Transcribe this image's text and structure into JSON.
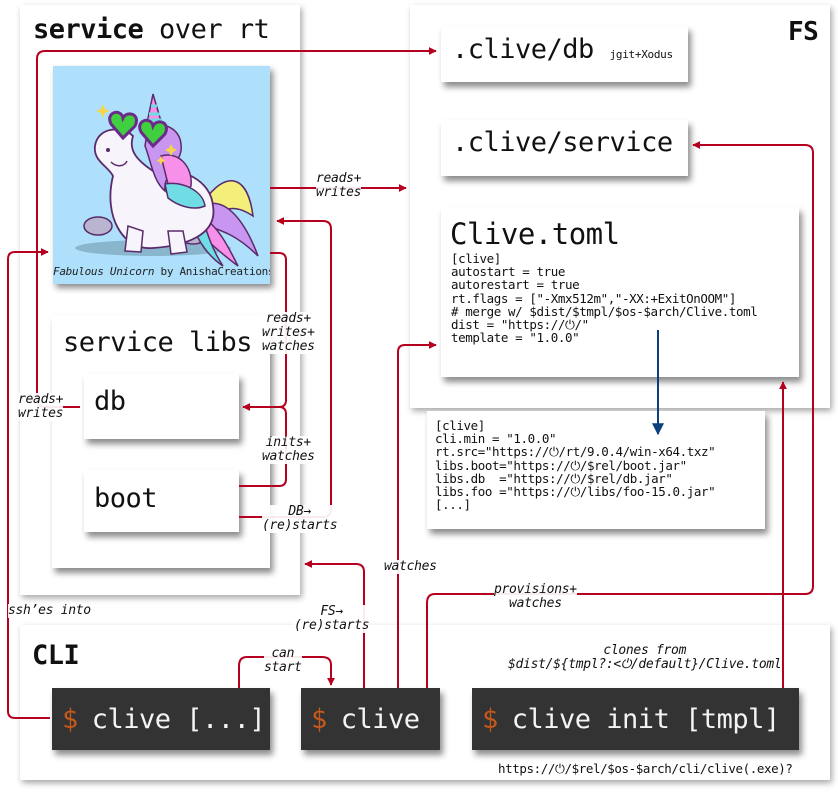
{
  "service_panel": {
    "title_bold": "service",
    "title_rest": " over rt",
    "image_caption_title": "Fabulous Unicorn",
    "image_caption_by": " by AnishaCreations",
    "libs": {
      "title": "service libs",
      "db": "db",
      "boot": "boot"
    }
  },
  "fs_panel": {
    "title": "FS",
    "db_dir": ".clive/db",
    "db_dir_note": "jgit+Xodus",
    "service_dir": ".clive/service",
    "toml": {
      "title": "Clive.toml",
      "lines": [
        "[clive]",
        "autostart = true",
        "autorestart = true",
        "rt.flags = [\"-Xmx512m\",\"-XX:+ExitOnOOM\"]",
        "# merge w/ $dist/$tmpl/$os-$arch/Clive.toml",
        "dist = \"https://⏻/\"",
        "template = \"1.0.0\""
      ]
    },
    "merged": {
      "lines": [
        "[clive]",
        "cli.min = \"1.0.0\"",
        "rt.src=\"https://⏻/rt/9.0.4/win-x64.txz\"",
        "libs.boot=\"https://⏻/$rel/boot.jar\"",
        "libs.db  =\"https://⏻/$rel/db.jar\"",
        "libs.foo =\"https://⏻/libs/foo-15.0.jar\"",
        "[...]"
      ]
    }
  },
  "cli_panel": {
    "title": "CLI",
    "prompt": "$",
    "cmd_any": "clive [...]",
    "cmd_clive": "clive",
    "cmd_init": "clive init [tmpl]",
    "clones_note": "clones from\n$dist/${tmpl?:<⏻/default}/Clive.toml",
    "download_url": "https://⏻/$rel/$os-$arch/cli/clive(.exe)?"
  },
  "edge_labels": {
    "reads_writes_fs": "reads+\nwrites",
    "reads_writes_watches": "reads+\nwrites+\nwatches",
    "reads_writes_db": "reads+\nwrites",
    "inits_watches": "inits+\nwatches",
    "db_restarts": "DB→\n(re)starts",
    "watches": "watches",
    "ssh": "ssh’es into",
    "fs_restarts": "FS→\n(re)starts",
    "can_start": "can\nstart",
    "provisions_watches": "provisions+\nwatches"
  },
  "colors": {
    "wire": "#b5001f",
    "merge_arrow": "#0b3f7d",
    "terminal_bg": "#333333",
    "prompt": "#c8581a",
    "image_bg": "#aee0fb"
  }
}
